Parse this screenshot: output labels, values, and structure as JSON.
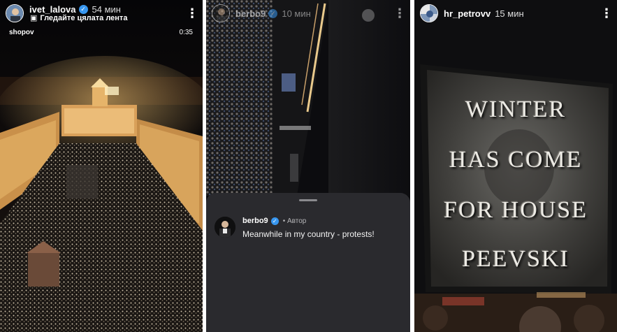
{
  "stories": [
    {
      "username": "ivet_lalova",
      "time": "54 мин",
      "subtitle": "Гледайте цялата лента",
      "music": "shopov",
      "duration": "0:35"
    },
    {
      "username": "berbo9",
      "time": "10 мин",
      "comment": {
        "username": "berbo9",
        "role": "• Автор",
        "text": "Meanwhile in my country - protests!"
      }
    },
    {
      "username": "hr_petrovv",
      "time": "15 мин",
      "sign_lines": [
        "WINTER",
        "HAS COME",
        "FOR HOUSE",
        "PEEVSKI"
      ]
    }
  ],
  "icons": {
    "verified": "verified-badge-icon",
    "more": "more-options-icon",
    "reel": "reel-icon"
  },
  "colors": {
    "verified": "#3897f0",
    "comment_bg": "#2a2a2e"
  }
}
